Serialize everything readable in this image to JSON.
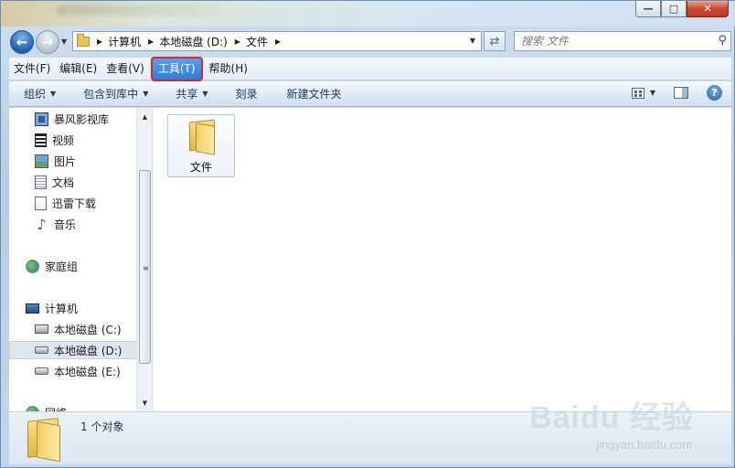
{
  "address": {
    "crumbs": [
      "计算机",
      "本地磁盘 (D:)",
      "文件"
    ]
  },
  "search": {
    "placeholder": "搜索 文件"
  },
  "menubar": {
    "items": [
      "文件(F)",
      "编辑(E)",
      "查看(V)",
      "工具(T)",
      "帮助(H)"
    ],
    "active_index": 3
  },
  "toolbar": {
    "organize": "组织",
    "include_in_library": "包含到库中",
    "share": "共享",
    "burn": "刻录",
    "new_folder": "新建文件夹"
  },
  "navpane": {
    "libraries": [
      "暴风影视库",
      "视频",
      "图片",
      "文档",
      "迅雷下载",
      "音乐"
    ],
    "homegroup": "家庭组",
    "computer": "计算机",
    "drives": [
      "本地磁盘 (C:)",
      "本地磁盘 (D:)",
      "本地磁盘 (E:)"
    ],
    "selected_drive_index": 1,
    "network_partial": "网络"
  },
  "content": {
    "items": [
      {
        "name": "文件",
        "type": "folder"
      }
    ]
  },
  "status": {
    "text": "1 个对象"
  },
  "watermark": {
    "brand": "Baidu 经验",
    "url": "jingyan.baidu.com"
  },
  "colors": {
    "menu_highlight": "#2b7be0",
    "annotation_red": "#d62a2a",
    "folder_yellow": "#e8c55a"
  },
  "icons": {
    "back": "arrow-left-icon",
    "forward": "arrow-right-icon",
    "search": "magnifier-icon",
    "help": "question-icon"
  }
}
